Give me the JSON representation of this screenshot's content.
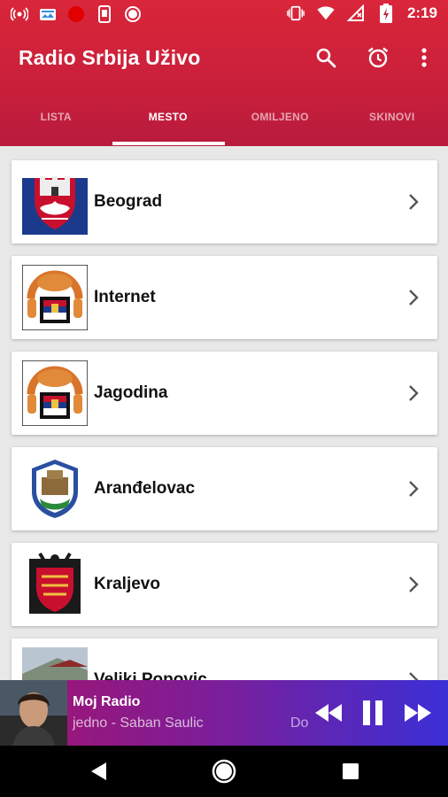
{
  "status_bar": {
    "time": "2:19",
    "left_icons": [
      "radio-signal-icon",
      "cloud-photo-icon",
      "record-dot-icon",
      "phone-icon",
      "circle-icon"
    ],
    "right_icons": [
      "vibrate-icon",
      "wifi-icon",
      "no-sim-icon",
      "battery-charging-icon"
    ]
  },
  "app_bar": {
    "title": "Radio Srbija Uživo",
    "actions": [
      "search-icon",
      "alarm-icon",
      "more-vert-icon"
    ]
  },
  "tabs": [
    {
      "label": "LISTA",
      "active": false
    },
    {
      "label": "MESTO",
      "active": true
    },
    {
      "label": "OMILJENO",
      "active": false
    },
    {
      "label": "SKINOVI",
      "active": false
    }
  ],
  "places": [
    {
      "name": "Beograd",
      "logo": "beograd-coat-of-arms-icon"
    },
    {
      "name": "Internet",
      "logo": "radio-serbia-logo-icon"
    },
    {
      "name": "Jagodina",
      "logo": "radio-serbia-logo-icon"
    },
    {
      "name": "Aranđelovac",
      "logo": "arandjelovac-coat-of-arms-icon"
    },
    {
      "name": "Kraljevo",
      "logo": "kraljevo-coat-of-arms-icon"
    },
    {
      "name": "Veliki Popovic",
      "logo": "veliki-popovic-photo"
    }
  ],
  "player": {
    "station": "Moj Radio",
    "track": "jedno - Saban Saulic",
    "track_extra": "Do",
    "controls": [
      "rewind-icon",
      "pause-icon",
      "fast-forward-icon"
    ]
  },
  "nav_bar": [
    "back-icon",
    "home-icon",
    "recents-icon"
  ],
  "colors": {
    "header_top": "#d9263a",
    "header_bottom": "#b81b3d",
    "player_start": "#a4136e",
    "player_end": "#3b2fd6",
    "list_background": "#e8e8e8"
  }
}
